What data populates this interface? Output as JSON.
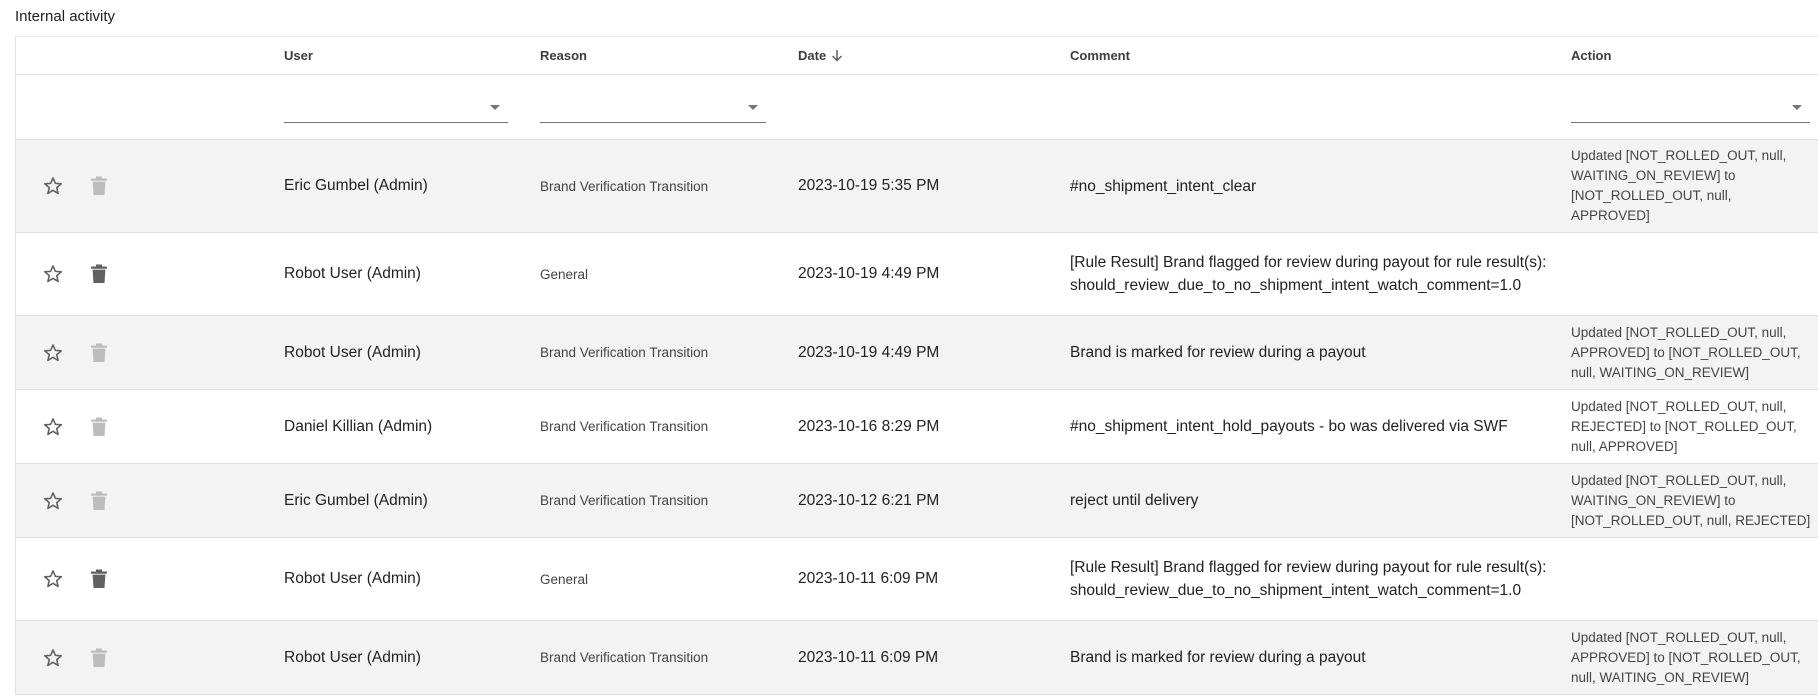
{
  "section": {
    "title": "Internal activity"
  },
  "table": {
    "columns": {
      "user": "User",
      "reason": "Reason",
      "date": "Date",
      "comment": "Comment",
      "action": "Action"
    },
    "sort": {
      "column": "date",
      "direction": "descending",
      "icon": "arrow-down-icon"
    },
    "filters": {
      "user": "",
      "reason": "",
      "action": ""
    },
    "rows": [
      {
        "user": "Eric Gumbel (Admin)",
        "reason": "Brand Verification Transition",
        "date": "2023-10-19 5:35 PM",
        "comment": "#no_shipment_intent_clear",
        "action": [
          "Updated [NOT_ROLLED_OUT, null,",
          "WAITING_ON_REVIEW] to",
          "[NOT_ROLLED_OUT, null,",
          "APPROVED]"
        ],
        "delete_enabled": false
      },
      {
        "user": "Robot User (Admin)",
        "reason": "General",
        "date": "2023-10-19 4:49 PM",
        "comment": "[Rule Result] Brand flagged for review during payout for rule result(s): should_review_due_to_no_shipment_intent_watch_comment=1.0",
        "action": [],
        "delete_enabled": true
      },
      {
        "user": "Robot User (Admin)",
        "reason": "Brand Verification Transition",
        "date": "2023-10-19 4:49 PM",
        "comment": "Brand is marked for review during a payout",
        "action": [
          "Updated [NOT_ROLLED_OUT, null,",
          "APPROVED] to [NOT_ROLLED_OUT,",
          "null, WAITING_ON_REVIEW]"
        ],
        "delete_enabled": false
      },
      {
        "user": "Daniel Killian (Admin)",
        "reason": "Brand Verification Transition",
        "date": "2023-10-16 8:29 PM",
        "comment": "#no_shipment_intent_hold_payouts - bo was delivered via SWF",
        "action": [
          "Updated [NOT_ROLLED_OUT, null,",
          "REJECTED] to [NOT_ROLLED_OUT,",
          "null, APPROVED]"
        ],
        "delete_enabled": false
      },
      {
        "user": "Eric Gumbel (Admin)",
        "reason": "Brand Verification Transition",
        "date": "2023-10-12 6:21 PM",
        "comment": "reject until delivery",
        "action": [
          "Updated [NOT_ROLLED_OUT, null,",
          "WAITING_ON_REVIEW] to",
          "[NOT_ROLLED_OUT, null, REJECTED]"
        ],
        "delete_enabled": false
      },
      {
        "user": "Robot User (Admin)",
        "reason": "General",
        "date": "2023-10-11 6:09 PM",
        "comment": "[Rule Result] Brand flagged for review during payout for rule result(s): should_review_due_to_no_shipment_intent_watch_comment=1.0",
        "action": [],
        "delete_enabled": true
      },
      {
        "user": "Robot User (Admin)",
        "reason": "Brand Verification Transition",
        "date": "2023-10-11 6:09 PM",
        "comment": "Brand is marked for review during a payout",
        "action": [
          "Updated [NOT_ROLLED_OUT, null,",
          "APPROVED] to [NOT_ROLLED_OUT,",
          "null, WAITING_ON_REVIEW]"
        ],
        "delete_enabled": false
      }
    ]
  },
  "icons": {
    "star": "star-outline-icon",
    "delete": "trash-icon",
    "dropdown": "chevron-down-icon"
  },
  "colors": {
    "row_shaded": "#f3f3f3",
    "icon_active": "#616161",
    "icon_disabled": "#bdbdbd",
    "border": "#e0e0e0"
  }
}
